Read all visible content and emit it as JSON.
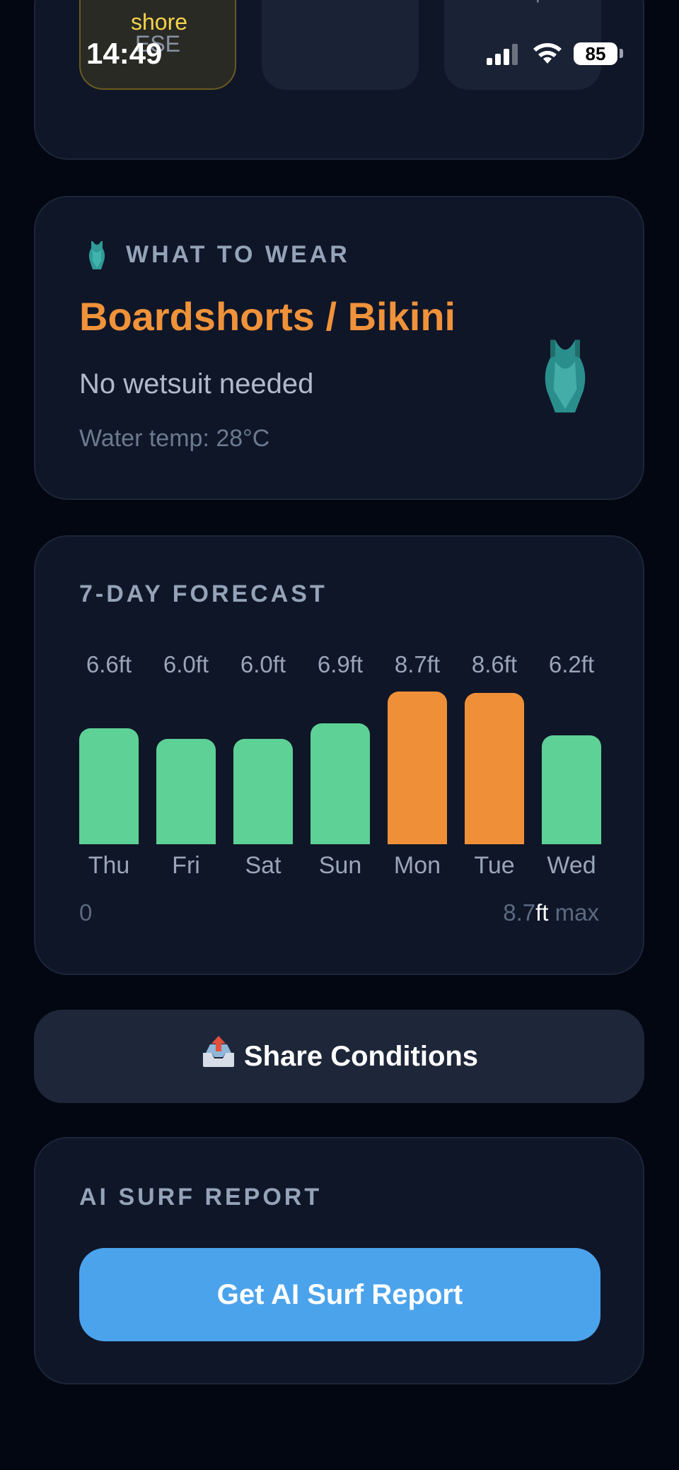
{
  "status_bar": {
    "time": "14:49",
    "battery": "85"
  },
  "conditions": {
    "wind_tile": {
      "type": "Cross-shore",
      "direction": "ESE"
    },
    "temp_tile": {
      "label": "temp"
    }
  },
  "what_to_wear": {
    "section_title": "WHAT TO WEAR",
    "headline": "Boardshorts / Bikini",
    "subtitle": "No wetsuit needed",
    "water_temp": "Water temp: 28°C"
  },
  "forecast": {
    "section_title": "7-DAY FORECAST",
    "scale_min": "0",
    "scale_max_value": "8.7",
    "scale_max_unit": "ft",
    "scale_max_suffix": " max",
    "colors": {
      "normal": "#5ed196",
      "big": "#ef9038"
    }
  },
  "chart_data": {
    "type": "bar",
    "categories": [
      "Thu",
      "Fri",
      "Sat",
      "Sun",
      "Mon",
      "Tue",
      "Wed"
    ],
    "values": [
      6.6,
      6.0,
      6.0,
      6.9,
      8.7,
      8.6,
      6.2
    ],
    "value_labels": [
      "6.6ft",
      "6.0ft",
      "6.0ft",
      "6.9ft",
      "8.7ft",
      "8.6ft",
      "6.2ft"
    ],
    "unit": "ft",
    "ylim": [
      0,
      8.7
    ],
    "highlighted": [
      "Mon",
      "Tue"
    ],
    "title": "7-DAY FORECAST"
  },
  "share": {
    "label": "Share Conditions",
    "icon": "outbox-tray-icon"
  },
  "ai_report": {
    "section_title": "AI SURF REPORT",
    "button_label": "Get AI Surf Report"
  }
}
